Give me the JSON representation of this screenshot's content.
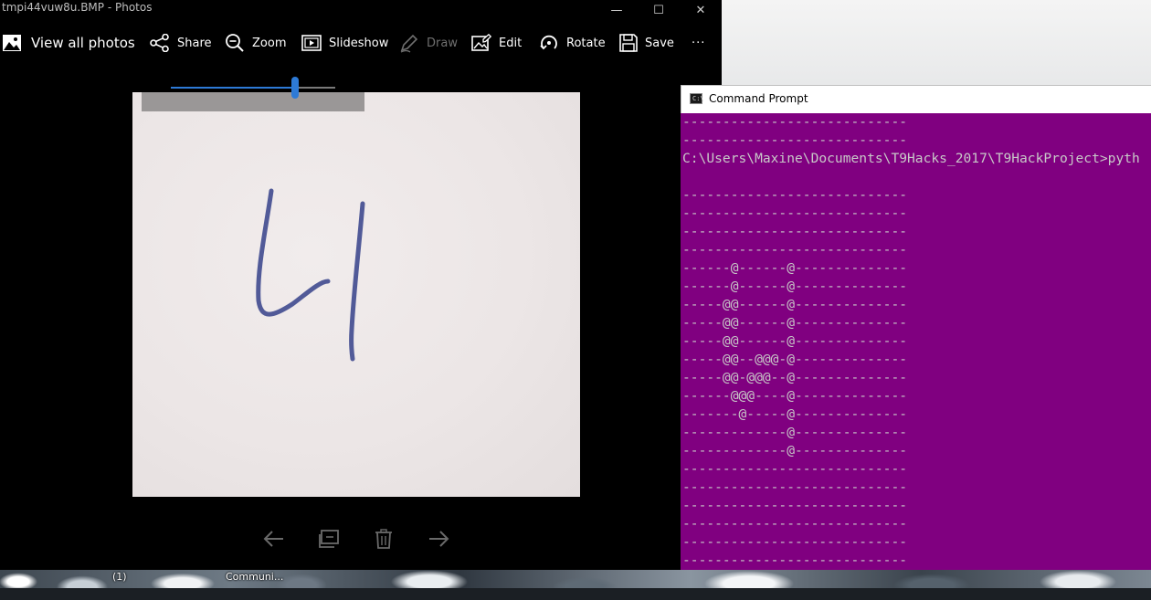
{
  "photos_window": {
    "title": "tmpi44vuw8u.BMP - Photos",
    "window_controls": {
      "minimize": "—",
      "maximize": "☐",
      "close": "✕"
    },
    "toolbar": {
      "view_all": "View all photos",
      "share": "Share",
      "zoom": "Zoom",
      "slideshow": "Slideshow",
      "draw": "Draw",
      "edit": "Edit",
      "rotate": "Rotate",
      "save": "Save",
      "more": "···"
    },
    "zoom_slider_fraction": 0.755,
    "photo_glyph": "4",
    "colors": {
      "accent": "#2d7ad6",
      "background": "#000000",
      "photo_paper": "#ece6e6",
      "ink": "#3f4a8f"
    }
  },
  "cmd_window": {
    "title": "Command Prompt",
    "icon_label": "C:\\",
    "background": "#800080",
    "text_color": "#c8c8c8",
    "lines": [
      "----------------------------",
      "----------------------------",
      "C:\\Users\\Maxine\\Documents\\T9Hacks_2017\\T9HackProject>pyth",
      "",
      "----------------------------",
      "----------------------------",
      "----------------------------",
      "----------------------------",
      "------@------@--------------",
      "------@------@--------------",
      "-----@@------@--------------",
      "-----@@------@--------------",
      "-----@@------@--------------",
      "-----@@--@@@-@--------------",
      "-----@@-@@@--@--------------",
      "------@@@----@--------------",
      "-------@-----@--------------",
      "-------------@--------------",
      "-------------@--------------",
      "----------------------------",
      "----------------------------",
      "----------------------------",
      "----------------------------",
      "----------------------------",
      "----------------------------"
    ]
  },
  "taskbar": {
    "items": [
      "(1)",
      "Communi..."
    ]
  }
}
